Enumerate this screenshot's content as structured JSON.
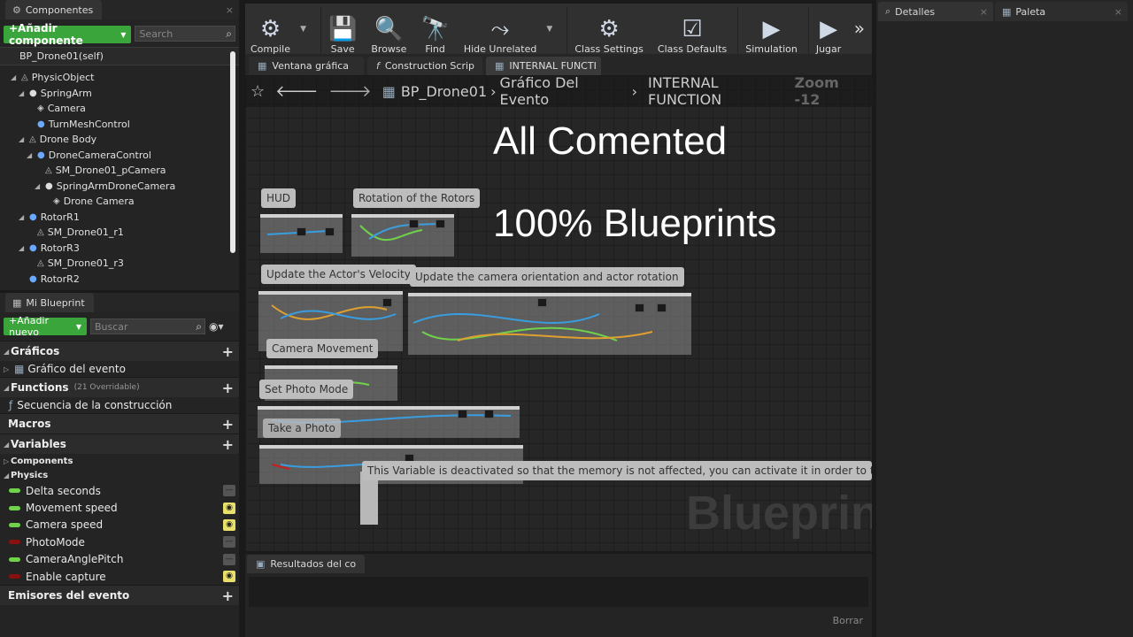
{
  "components_panel": {
    "tab_label": "Componentes",
    "add_button": "+Añadir componente",
    "search_placeholder": "Search",
    "self_item": "BP_Drone01(self)",
    "tree": [
      {
        "label": "PhysicObject",
        "depth": 0,
        "icon": "actor-icon"
      },
      {
        "label": "SpringArm",
        "depth": 1,
        "icon": "springarm-icon"
      },
      {
        "label": "Camera",
        "depth": 2,
        "icon": "camera-icon"
      },
      {
        "label": "TurnMeshControl",
        "depth": 2,
        "icon": "sphere-icon"
      },
      {
        "label": "Drone Body",
        "depth": 1,
        "icon": "actor-icon"
      },
      {
        "label": "DroneCameraControl",
        "depth": 2,
        "icon": "sphere-icon"
      },
      {
        "label": "SM_Drone01_pCamera",
        "depth": 3,
        "icon": "actor-icon"
      },
      {
        "label": "SpringArmDroneCamera",
        "depth": 3,
        "icon": "springarm-icon"
      },
      {
        "label": "Drone Camera",
        "depth": 4,
        "icon": "camera-icon"
      },
      {
        "label": "RotorR1",
        "depth": 1,
        "icon": "sphere-icon"
      },
      {
        "label": "SM_Drone01_r1",
        "depth": 2,
        "icon": "actor-icon"
      },
      {
        "label": "RotorR3",
        "depth": 1,
        "icon": "sphere-icon"
      },
      {
        "label": "SM_Drone01_r3",
        "depth": 2,
        "icon": "actor-icon"
      },
      {
        "label": "RotorR2",
        "depth": 1,
        "icon": "sphere-icon"
      }
    ]
  },
  "myblueprint": {
    "tab_label": "Mi Blueprint",
    "add_button": "+Añadir nuevo",
    "search_placeholder": "Buscar",
    "graphs_header": "Gráficos",
    "event_graph": "Gráfico del evento",
    "functions_header": "Functions",
    "functions_note": "(21 Overridable)",
    "construction": "Secuencia de la construcción",
    "macros_header": "Macros",
    "variables_header": "Variables",
    "cat_components": "Components",
    "cat_physics": "Physics",
    "variables": [
      {
        "name": "Delta seconds",
        "color": "#6fd24a",
        "visible": false
      },
      {
        "name": "Movement speed",
        "color": "#6fd24a",
        "visible": true
      },
      {
        "name": "Camera speed",
        "color": "#6fd24a",
        "visible": true
      },
      {
        "name": "PhotoMode",
        "color": "#8a0f0f",
        "visible": false
      },
      {
        "name": "CameraAnglePitch",
        "color": "#6fd24a",
        "visible": false
      },
      {
        "name": "Enable capture",
        "color": "#8a0f0f",
        "visible": true
      }
    ],
    "dispatchers_header": "Emisores del evento"
  },
  "toolbar": {
    "buttons": [
      {
        "label": "Compile",
        "icon": "compile-icon"
      },
      {
        "label": "Save",
        "icon": "save-icon"
      },
      {
        "label": "Browse",
        "icon": "browse-icon"
      },
      {
        "label": "Find",
        "icon": "find-icon"
      },
      {
        "label": "Hide Unrelated",
        "icon": "hide-unrelated-icon"
      },
      {
        "label": "Class Settings",
        "icon": "class-settings-icon"
      },
      {
        "label": "Class Defaults",
        "icon": "class-defaults-icon"
      },
      {
        "label": "Simulation",
        "icon": "simulation-icon"
      },
      {
        "label": "Jugar",
        "icon": "play-icon"
      }
    ]
  },
  "doc_tabs": [
    "Ventana gráfica",
    "Construction Scrip",
    "INTERNAL FUNCTI"
  ],
  "graph": {
    "breadcrumb_root": "BP_Drone01",
    "breadcrumb_mid": "Gráfico Del Evento",
    "breadcrumb_leaf": "INTERNAL FUNCTION",
    "zoom": "Zoom -12",
    "headline1": "All Comented",
    "headline2": "100% Blueprints",
    "watermark": "Blueprint",
    "comments": [
      "HUD",
      "Rotation of the Rotors",
      "Update the Actor's Velocity",
      "Update the camera orientation and actor rotation",
      "Camera Movement",
      "Set Photo Mode",
      "Take a Photo",
      "This Variable is deactivated so that the memory is not affected, you can activate it in order to take photos y"
    ]
  },
  "results": {
    "tab_label": "Resultados del co",
    "clear_button": "Borrar"
  },
  "right_tabs": {
    "details": "Detalles",
    "palette": "Paleta"
  }
}
